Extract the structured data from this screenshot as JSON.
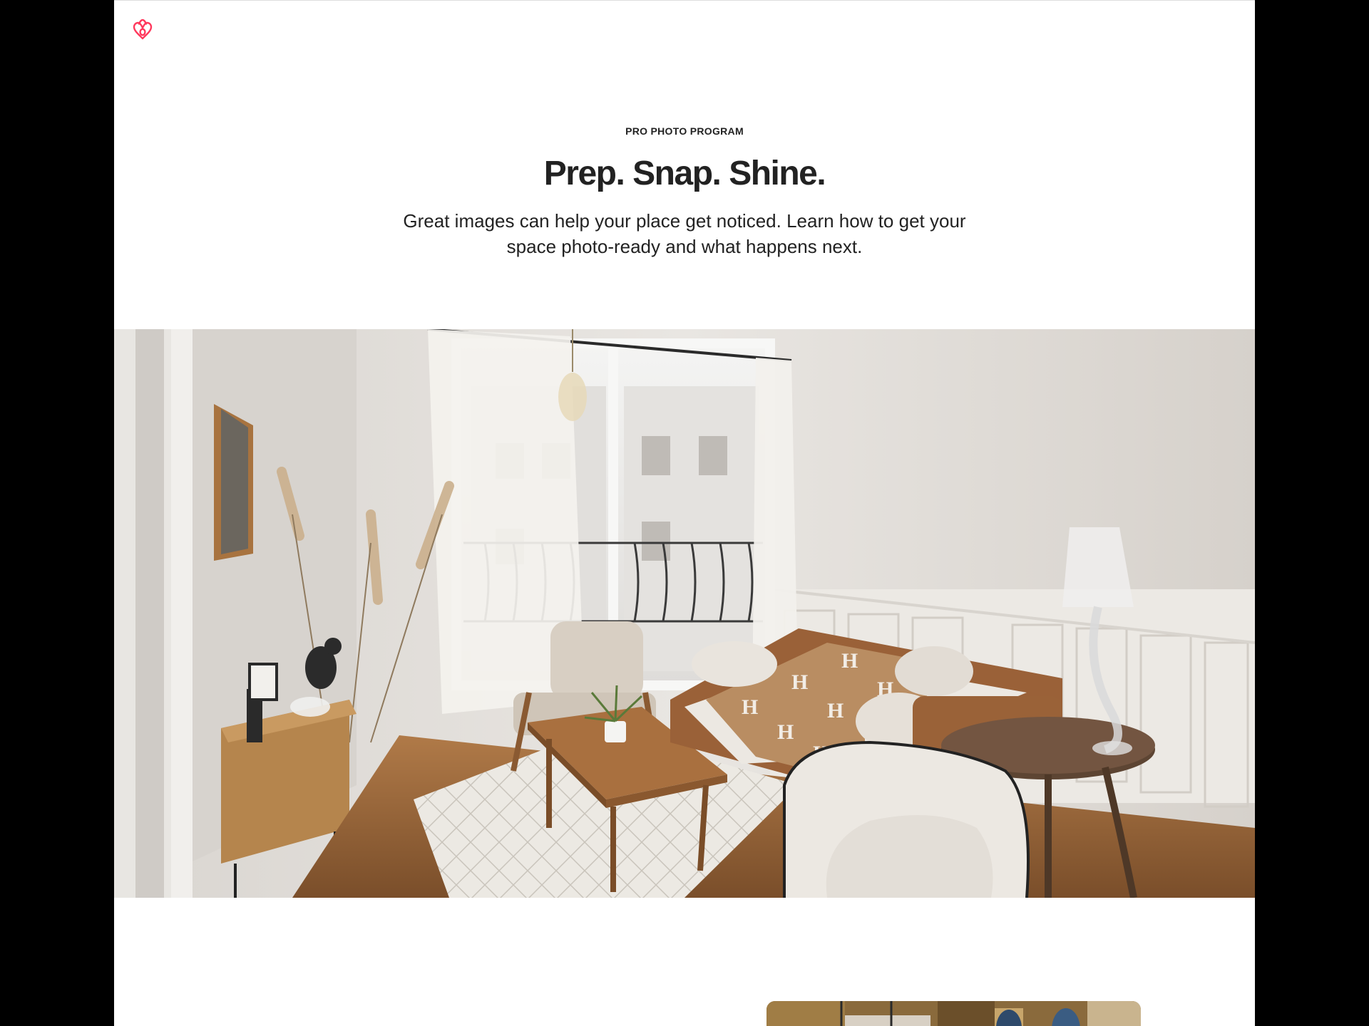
{
  "brand": {
    "logo_icon": "airbnb-logo-icon",
    "color": "#FF385C"
  },
  "hero": {
    "eyebrow": "PRO PHOTO PROGRAM",
    "title": "Prep. Snap. Shine.",
    "subtitle": "Great images can help your place get noticed. Learn how to get your space photo-ready and what happens next."
  },
  "colors": {
    "text": "#222222",
    "background": "#FFFFFF",
    "frame": "#000000"
  }
}
